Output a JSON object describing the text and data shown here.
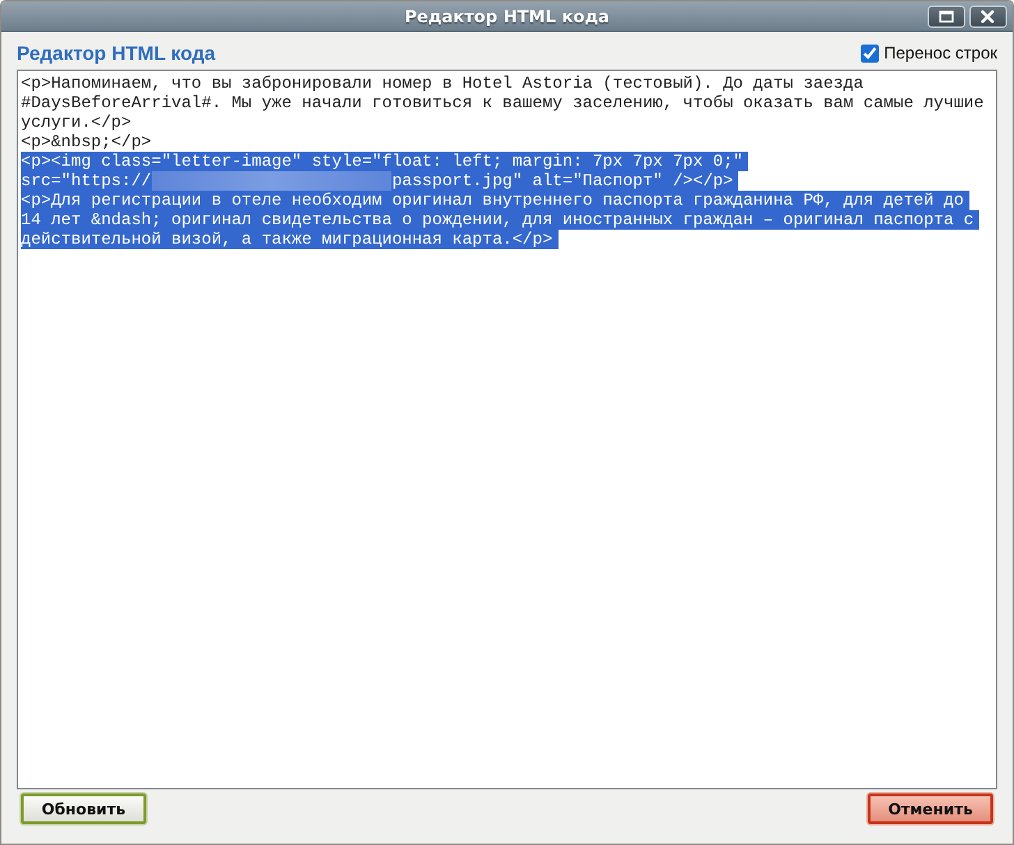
{
  "window": {
    "title": "Редактор HTML кода",
    "controls": [
      {
        "kind": "maximize"
      },
      {
        "kind": "close"
      }
    ]
  },
  "editor": {
    "heading": "Редактор HTML кода",
    "word_wrap": {
      "label": "Перенос строк",
      "checked": true
    },
    "lines": [
      {
        "kind": "text",
        "text": "<p>Напоминаем, что вы забронировали номер в Hotel Astoria (тестовый). До даты заезда",
        "selected": false
      },
      {
        "kind": "text",
        "text": "#DaysBeforeArrival#. Мы уже начали готовиться к вашему заселению, чтобы оказать вам самые лучшие",
        "selected": false
      },
      {
        "kind": "text",
        "text": "услуги.</p>",
        "selected": false
      },
      {
        "kind": "text",
        "text": "<p>&nbsp;</p>",
        "selected": false
      },
      {
        "kind": "text",
        "text": "<p><img class=\"letter-image\" style=\"float: left; margin: 7px 7px 7px 0;\"",
        "selected": true
      },
      {
        "kind": "redacted",
        "before": "src=\"https://",
        "after": "passport.jpg\" alt=\"Паспорт\" /></p>",
        "selected": true
      },
      {
        "kind": "text",
        "text": "<p>Для регистрации в отеле необходим оригинал внутреннего паспорта гражданина РФ, для детей до",
        "selected": true
      },
      {
        "kind": "text",
        "text": "14 лет &ndash; оригинал свидетельства о рождении, для иностранных граждан – оригинал паспорта с",
        "selected": true
      },
      {
        "kind": "text",
        "text": "действительной визой, а также миграционная карта.</p>",
        "selected": true
      }
    ]
  },
  "buttons": [
    {
      "kind": "refresh",
      "label": "Обновить"
    },
    {
      "kind": "cancel",
      "label": "Отменить"
    }
  ]
}
